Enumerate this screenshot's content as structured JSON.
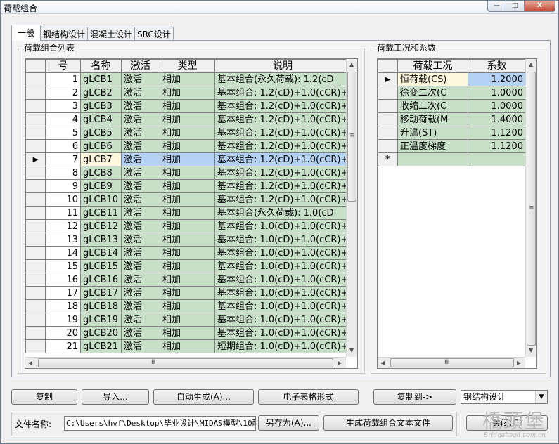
{
  "window": {
    "title": "荷载组合",
    "controls": {
      "minimize": "—",
      "maximize": "□",
      "close": "X"
    }
  },
  "tabs": [
    {
      "label": "一般",
      "active": true
    },
    {
      "label": "钢结构设计"
    },
    {
      "label": "混凝土设计"
    },
    {
      "label": "SRC设计"
    }
  ],
  "combo_list": {
    "title": "荷载组合列表",
    "headers": [
      "号",
      "名称",
      "激活",
      "类型",
      "说明"
    ],
    "current_row": 7,
    "rows": [
      {
        "no": "1",
        "name": "gLCB1",
        "active": "激活",
        "type": "相加",
        "desc": "基本组合(永久荷载): 1.2(cD"
      },
      {
        "no": "2",
        "name": "gLCB2",
        "active": "激活",
        "type": "相加",
        "desc": "基本组合: 1.2(cD)+1.0(cCR)+"
      },
      {
        "no": "3",
        "name": "gLCB3",
        "active": "激活",
        "type": "相加",
        "desc": "基本组合: 1.2(cD)+1.0(cCR)+"
      },
      {
        "no": "4",
        "name": "gLCB4",
        "active": "激活",
        "type": "相加",
        "desc": "基本组合: 1.2(cD)+1.0(cCR)+"
      },
      {
        "no": "5",
        "name": "gLCB5",
        "active": "激活",
        "type": "相加",
        "desc": "基本组合: 1.2(cD)+1.0(cCR)+"
      },
      {
        "no": "6",
        "name": "gLCB6",
        "active": "激活",
        "type": "相加",
        "desc": "基本组合: 1.2(cD)+1.0(cCR)+"
      },
      {
        "no": "7",
        "name": "gLCB7",
        "active": "激活",
        "type": "相加",
        "desc": "基本组合: 1.2(cD)+1.0(cCR)+"
      },
      {
        "no": "8",
        "name": "gLCB8",
        "active": "激活",
        "type": "相加",
        "desc": "基本组合: 1.2(cD)+1.0(cCR)+"
      },
      {
        "no": "9",
        "name": "gLCB9",
        "active": "激活",
        "type": "相加",
        "desc": "基本组合: 1.2(cD)+1.0(cCR)+"
      },
      {
        "no": "10",
        "name": "gLCB10",
        "active": "激活",
        "type": "相加",
        "desc": "基本组合: 1.2(cD)+1.0(cCR)+"
      },
      {
        "no": "11",
        "name": "gLCB11",
        "active": "激活",
        "type": "相加",
        "desc": "基本组合(永久荷载): 1.0(cD"
      },
      {
        "no": "12",
        "name": "gLCB12",
        "active": "激活",
        "type": "相加",
        "desc": "基本组合: 1.0(cD)+1.0(cCR)+"
      },
      {
        "no": "13",
        "name": "gLCB13",
        "active": "激活",
        "type": "相加",
        "desc": "基本组合: 1.0(cD)+1.0(cCR)+"
      },
      {
        "no": "14",
        "name": "gLCB14",
        "active": "激活",
        "type": "相加",
        "desc": "基本组合: 1.0(cD)+1.0(cCR)+"
      },
      {
        "no": "15",
        "name": "gLCB15",
        "active": "激活",
        "type": "相加",
        "desc": "基本组合: 1.0(cD)+1.0(cCR)+"
      },
      {
        "no": "16",
        "name": "gLCB16",
        "active": "激活",
        "type": "相加",
        "desc": "基本组合: 1.0(cD)+1.0(cCR)+"
      },
      {
        "no": "17",
        "name": "gLCB17",
        "active": "激活",
        "type": "相加",
        "desc": "基本组合: 1.0(cD)+1.0(cCR)+"
      },
      {
        "no": "18",
        "name": "gLCB18",
        "active": "激活",
        "type": "相加",
        "desc": "基本组合: 1.0(cD)+1.0(cCR)+"
      },
      {
        "no": "19",
        "name": "gLCB19",
        "active": "激活",
        "type": "相加",
        "desc": "基本组合: 1.0(cD)+1.0(cCR)+"
      },
      {
        "no": "20",
        "name": "gLCB20",
        "active": "激活",
        "type": "相加",
        "desc": "基本组合: 1.0(cD)+1.0(cCR)+"
      },
      {
        "no": "21",
        "name": "gLCB21",
        "active": "激活",
        "type": "相加",
        "desc": "短期组合: 1.0(cD)+1.0(cCR)+"
      }
    ]
  },
  "load_cases": {
    "title": "荷载工况和系数",
    "headers": [
      "荷载工况",
      "系数"
    ],
    "current_row": 1,
    "rows": [
      {
        "case": "恒荷载(CS)",
        "factor": "1.2000"
      },
      {
        "case": "徐变二次(C",
        "factor": "1.0000"
      },
      {
        "case": "收缩二次(C",
        "factor": "1.0000"
      },
      {
        "case": "移动荷载(M",
        "factor": "1.4000"
      },
      {
        "case": "升温(ST)",
        "factor": "1.1200"
      },
      {
        "case": "正温度梯度",
        "factor": "1.1200"
      }
    ],
    "new_row_marker": "*"
  },
  "buttons": {
    "copy": "复制",
    "import": "导入...",
    "auto_generate": "自动生成(A)...",
    "spreadsheet": "电子表格形式",
    "copy_to": "复制到->",
    "save_as": "另存为(A)...",
    "generate_text": "生成荷载组合文本文件",
    "close": "关闭(C)"
  },
  "copy_target": {
    "selected": "钢结构设计"
  },
  "file": {
    "label": "文件名称:",
    "value": "C:\\Users\\hvf\\Desktop\\毕业设计\\MIDAS模型\\10配"
  },
  "scroll_glyphs": {
    "up": "▲",
    "down": "▼",
    "left": "◀",
    "right": "▶",
    "grip_v": "≡",
    "grip_h": "Ⅲ"
  },
  "row_marker": "▶",
  "watermark": {
    "text": "橋頭堡",
    "url": "Bridgehead.com.cn"
  }
}
